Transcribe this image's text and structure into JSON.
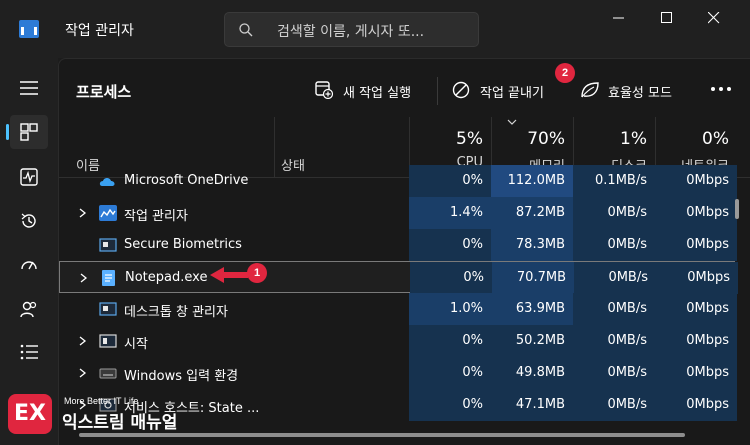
{
  "app": {
    "title": "작업 관리자",
    "search_placeholder": "검색할 이름, 게시자 또..."
  },
  "sidebar": {
    "items": [
      {
        "name": "hamburger",
        "active": false
      },
      {
        "name": "processes",
        "active": true
      },
      {
        "name": "performance",
        "active": false
      },
      {
        "name": "app-history",
        "active": false
      },
      {
        "name": "startup-apps",
        "active": false
      },
      {
        "name": "users",
        "active": false
      },
      {
        "name": "details",
        "active": false
      }
    ]
  },
  "toolbar": {
    "page_title": "프로세스",
    "run_new_task": "새 작업 실행",
    "end_task": "작업 끝내기",
    "efficiency_mode": "효율성 모드"
  },
  "columns": {
    "name": "이름",
    "status": "상태",
    "cpu": {
      "pct": "5%",
      "label": "CPU"
    },
    "memory": {
      "pct": "70%",
      "label": "메모리"
    },
    "disk": {
      "pct": "1%",
      "label": "디스크"
    },
    "network": {
      "pct": "0%",
      "label": "네트워크"
    }
  },
  "rows": [
    {
      "name": "Microsoft OneDrive",
      "cpu": "0%",
      "memory": "112.0MB",
      "disk": "0.1MB/s",
      "network": "0Mbps",
      "expand": false,
      "icon": "onedrive-icon"
    },
    {
      "name": "작업 관리자",
      "cpu": "1.4%",
      "memory": "87.2MB",
      "disk": "0MB/s",
      "network": "0Mbps",
      "expand": true,
      "icon": "task-manager-icon"
    },
    {
      "name": "Secure Biometrics",
      "cpu": "0%",
      "memory": "78.3MB",
      "disk": "0MB/s",
      "network": "0Mbps",
      "expand": false,
      "icon": "window-icon"
    },
    {
      "name": "Notepad.exe",
      "cpu": "0%",
      "memory": "70.7MB",
      "disk": "0MB/s",
      "network": "0Mbps",
      "expand": true,
      "icon": "notepad-icon",
      "selected": true
    },
    {
      "name": "데스크톱 창 관리자",
      "cpu": "1.0%",
      "memory": "63.9MB",
      "disk": "0MB/s",
      "network": "0Mbps",
      "expand": false,
      "icon": "window-icon"
    },
    {
      "name": "시작",
      "cpu": "0%",
      "memory": "50.2MB",
      "disk": "0MB/s",
      "network": "0Mbps",
      "expand": true,
      "icon": "start-icon"
    },
    {
      "name": "Windows 입력 환경",
      "cpu": "0%",
      "memory": "49.8MB",
      "disk": "0MB/s",
      "network": "0Mbps",
      "expand": true,
      "icon": "keyboard-icon"
    },
    {
      "name": "서비스 호스트: State ...",
      "cpu": "0%",
      "memory": "47.1MB",
      "disk": "0MB/s",
      "network": "0Mbps",
      "expand": true,
      "icon": "service-icon"
    }
  ],
  "annotations": {
    "badge1": "1",
    "badge2": "2"
  },
  "watermark": {
    "logo": "EX",
    "subtitle": "More Better IT Life",
    "title": "익스트림 매뉴얼"
  },
  "colors": {
    "accent": "#4cc2ff",
    "heat_light": "#16324f",
    "heat_mid": "#1a3e68",
    "heat_dark": "#214a80",
    "badge": "#e0263f"
  }
}
